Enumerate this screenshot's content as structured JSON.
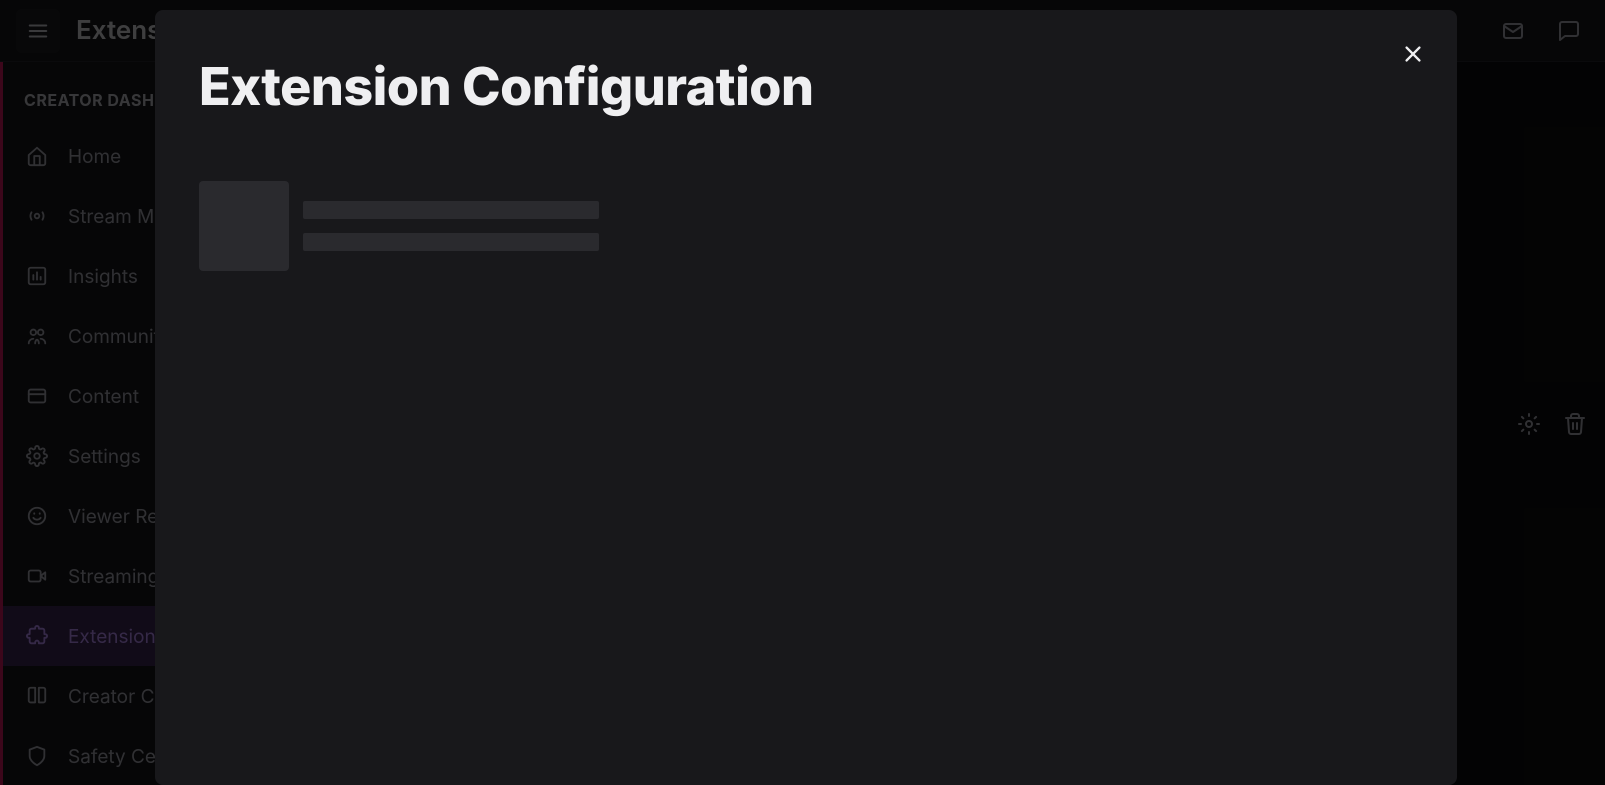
{
  "topbar": {
    "page_title": "Extensions"
  },
  "sidebar": {
    "header": "CREATOR DASHBOARD",
    "items": [
      {
        "label": "Home",
        "icon": "home"
      },
      {
        "label": "Stream Manager",
        "icon": "broadcast"
      },
      {
        "label": "Insights",
        "icon": "chart"
      },
      {
        "label": "Community",
        "icon": "people"
      },
      {
        "label": "Content",
        "icon": "panel"
      },
      {
        "label": "Settings",
        "icon": "gear"
      },
      {
        "label": "Viewer Rewards",
        "icon": "smile"
      },
      {
        "label": "Streaming Tools",
        "icon": "camera"
      },
      {
        "label": "Extensions",
        "icon": "puzzle",
        "active": true
      },
      {
        "label": "Creator Camp",
        "icon": "book"
      },
      {
        "label": "Safety Center",
        "icon": "shield"
      }
    ]
  },
  "modal": {
    "title": "Extension Configuration"
  }
}
